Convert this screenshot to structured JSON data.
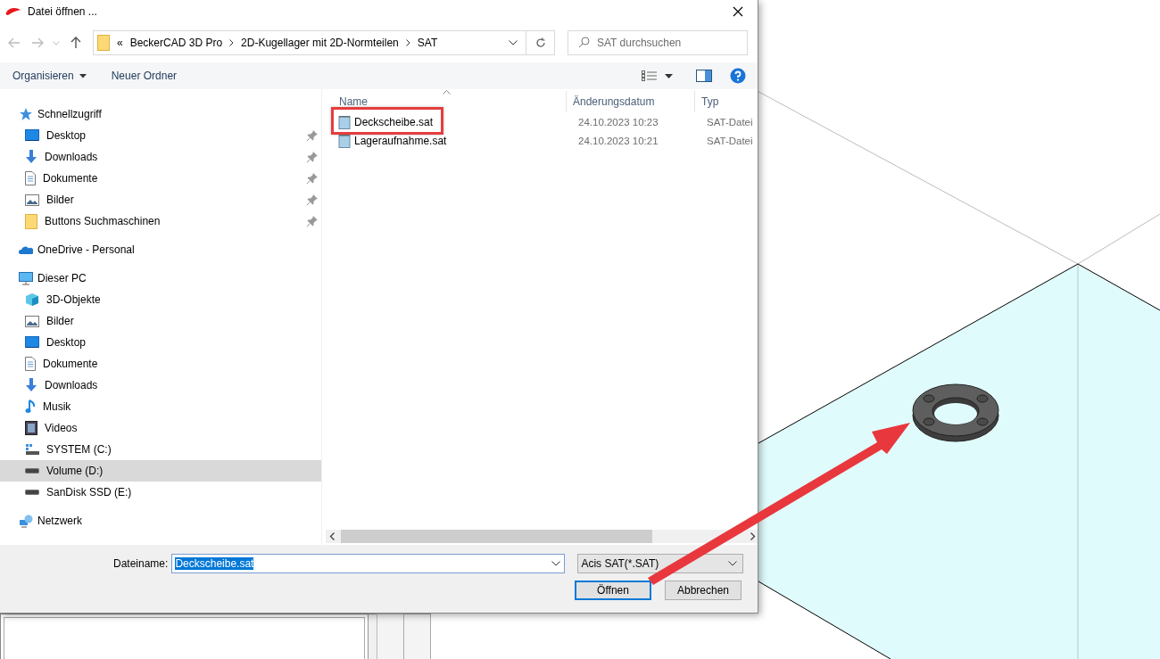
{
  "window": {
    "title": "Datei öffnen ..."
  },
  "address_bar": {
    "overflow": "«",
    "segments": [
      "BeckerCAD 3D Pro",
      "2D-Kugellager mit 2D-Normteilen",
      "SAT"
    ]
  },
  "search": {
    "placeholder": "SAT durchsuchen"
  },
  "toolbar": {
    "organize": "Organisieren",
    "new_folder": "Neuer Ordner"
  },
  "navigation": [
    {
      "label": "Schnellzugriff",
      "kind": "star",
      "selected": false,
      "children": [
        {
          "label": "Desktop",
          "kind": "desktop",
          "pinned": true,
          "selected": false
        },
        {
          "label": "Downloads",
          "kind": "download",
          "pinned": true,
          "selected": false
        },
        {
          "label": "Dokumente",
          "kind": "document",
          "pinned": true,
          "selected": false
        },
        {
          "label": "Bilder",
          "kind": "picture",
          "pinned": true,
          "selected": false
        },
        {
          "label": "Buttons Suchmaschinen",
          "kind": "folder",
          "pinned": true,
          "selected": false
        }
      ]
    },
    {
      "label": "OneDrive - Personal",
      "kind": "cloud",
      "selected": false
    },
    {
      "label": "Dieser PC",
      "kind": "pc",
      "selected": false,
      "children": [
        {
          "label": "3D-Objekte",
          "kind": "cube",
          "pinned": false,
          "selected": false
        },
        {
          "label": "Bilder",
          "kind": "picture",
          "pinned": false,
          "selected": false
        },
        {
          "label": "Desktop",
          "kind": "desktop",
          "pinned": false,
          "selected": false
        },
        {
          "label": "Dokumente",
          "kind": "document",
          "pinned": false,
          "selected": false
        },
        {
          "label": "Downloads",
          "kind": "download",
          "pinned": false,
          "selected": false
        },
        {
          "label": "Musik",
          "kind": "music",
          "pinned": false,
          "selected": false
        },
        {
          "label": "Videos",
          "kind": "video",
          "pinned": false,
          "selected": false
        },
        {
          "label": "SYSTEM (C:)",
          "kind": "system-drive",
          "pinned": false,
          "selected": false
        },
        {
          "label": "Volume (D:)",
          "kind": "drive",
          "pinned": false,
          "selected": true
        },
        {
          "label": "SanDisk SSD (E:)",
          "kind": "drive",
          "pinned": false,
          "selected": false
        }
      ]
    },
    {
      "label": "Netzwerk",
      "kind": "network",
      "selected": false
    }
  ],
  "file_list": {
    "columns": [
      {
        "label": "Name",
        "sorted": true
      },
      {
        "label": "Änderungsdatum",
        "sorted": false
      },
      {
        "label": "Typ",
        "sorted": false
      }
    ],
    "rows": [
      {
        "name": "Deckscheibe.sat",
        "date": "24.10.2023 10:23",
        "type": "SAT-Datei",
        "marked": true
      },
      {
        "name": "Lageraufnahme.sat",
        "date": "24.10.2023 10:21",
        "type": "SAT-Datei",
        "marked": false
      }
    ]
  },
  "footer": {
    "filename_label": "Dateiname:",
    "filename": "Deckscheibe.sat",
    "filter": "Acis SAT(*.SAT)",
    "buttons": [
      {
        "label": "Öffnen",
        "default": true
      },
      {
        "label": "Abbrechen",
        "default": false
      }
    ]
  }
}
